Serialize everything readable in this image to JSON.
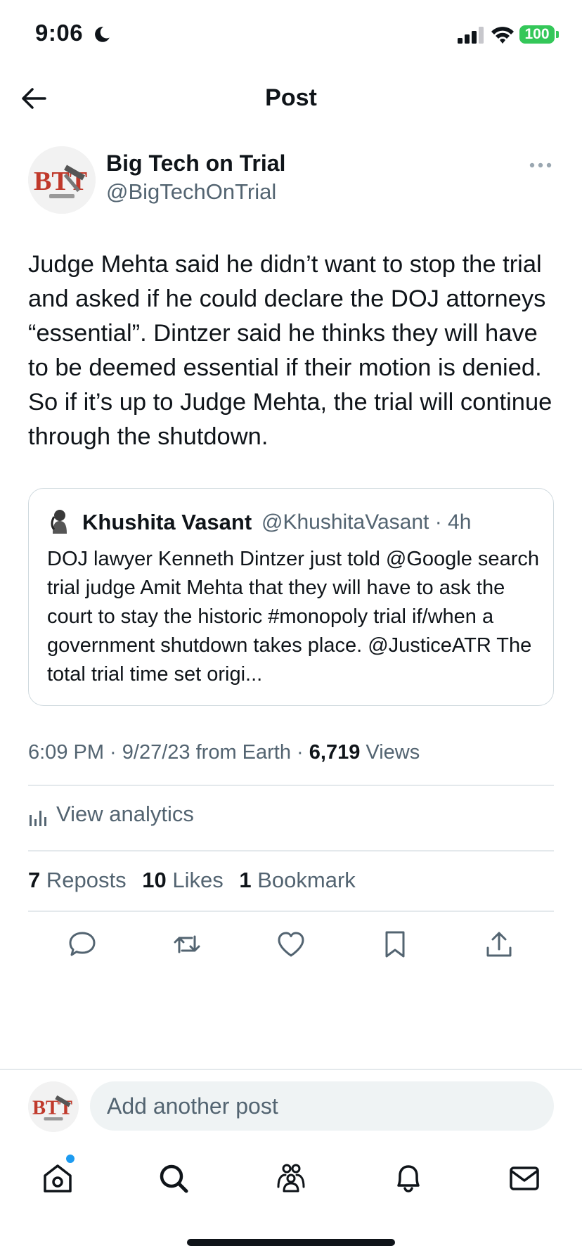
{
  "status_bar": {
    "time": "9:06",
    "battery": "100"
  },
  "header": {
    "title": "Post"
  },
  "post": {
    "author_name": "Big Tech on Trial",
    "author_handle": "@BigTechOnTrial",
    "avatar_text": "BTT",
    "text": "Judge Mehta said he didn’t want to stop the trial and asked if he could declare the DOJ attorneys “essential”. Dintzer said he thinks they will have to be deemed essential if their motion is denied. So if it’s up to Judge Mehta, the trial will continue through the shutdown.",
    "time": "6:09 PM",
    "date": "9/27/23",
    "source": "from Earth",
    "views_count": "6,719",
    "views_label": "Views",
    "analytics_label": "View analytics",
    "reposts_count": "7",
    "reposts_label": "Reposts",
    "likes_count": "10",
    "likes_label": "Likes",
    "bookmarks_count": "1",
    "bookmarks_label": "Bookmark"
  },
  "quote": {
    "author_name": "Khushita Vasant",
    "author_handle": "@KhushitaVasant",
    "age": "4h",
    "text": "DOJ lawyer Kenneth Dintzer just told @Google search trial judge Amit Mehta that they will have to ask the court to stay the historic #monopoly trial if/when a government shutdown takes place. @JusticeATR The total trial time set origi..."
  },
  "compose": {
    "placeholder": "Add another post"
  },
  "icons": {
    "back": "arrow-left-icon",
    "more": "more-icon",
    "analytics": "bar-chart-icon",
    "reply": "reply-icon",
    "repost": "repost-icon",
    "like": "heart-icon",
    "bookmark": "bookmark-icon",
    "share": "share-icon",
    "tabs": [
      "home-icon",
      "search-icon",
      "communities-icon",
      "notifications-icon",
      "messages-icon"
    ]
  },
  "colors": {
    "text": "#0f1419",
    "secondary": "#536471",
    "border": "#cfd9de",
    "accent": "#1d9bf0",
    "battery": "#34c759"
  }
}
